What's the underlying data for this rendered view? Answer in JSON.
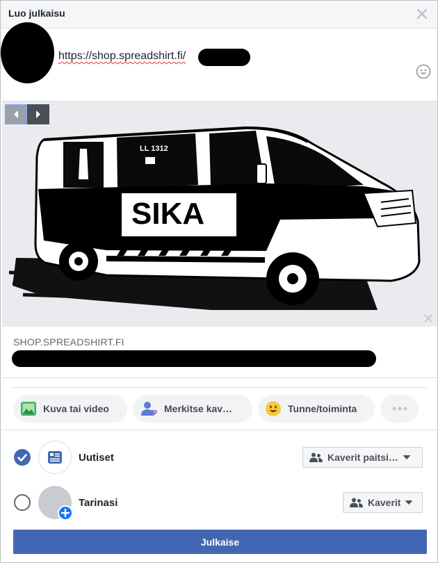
{
  "dialog": {
    "title": "Luo julkaisu"
  },
  "composer": {
    "text": "https://shop.spreadshirt.fi/"
  },
  "preview": {
    "domain": "SHOP.SPREADSHIRT.FI",
    "image_text": {
      "vehicle_number": "LL 1312",
      "side_text": "SIKA"
    }
  },
  "actions": [
    {
      "label": "Kuva tai video",
      "icon": "photo-icon"
    },
    {
      "label": "Merkitse kav…",
      "icon": "tag-friends-icon"
    },
    {
      "label": "Tunne/toiminta",
      "icon": "feeling-icon"
    },
    {
      "label": "",
      "icon": "more-icon"
    }
  ],
  "share": {
    "news": {
      "label": "Uutiset",
      "audience": "Kaverit paitsi…",
      "checked": true
    },
    "story": {
      "label": "Tarinasi",
      "audience": "Kaverit",
      "checked": false
    }
  },
  "publish_label": "Julkaise",
  "colors": {
    "primary": "#4267b2",
    "header_bg": "#f5f6f7",
    "chip_bg": "#f2f3f5"
  }
}
